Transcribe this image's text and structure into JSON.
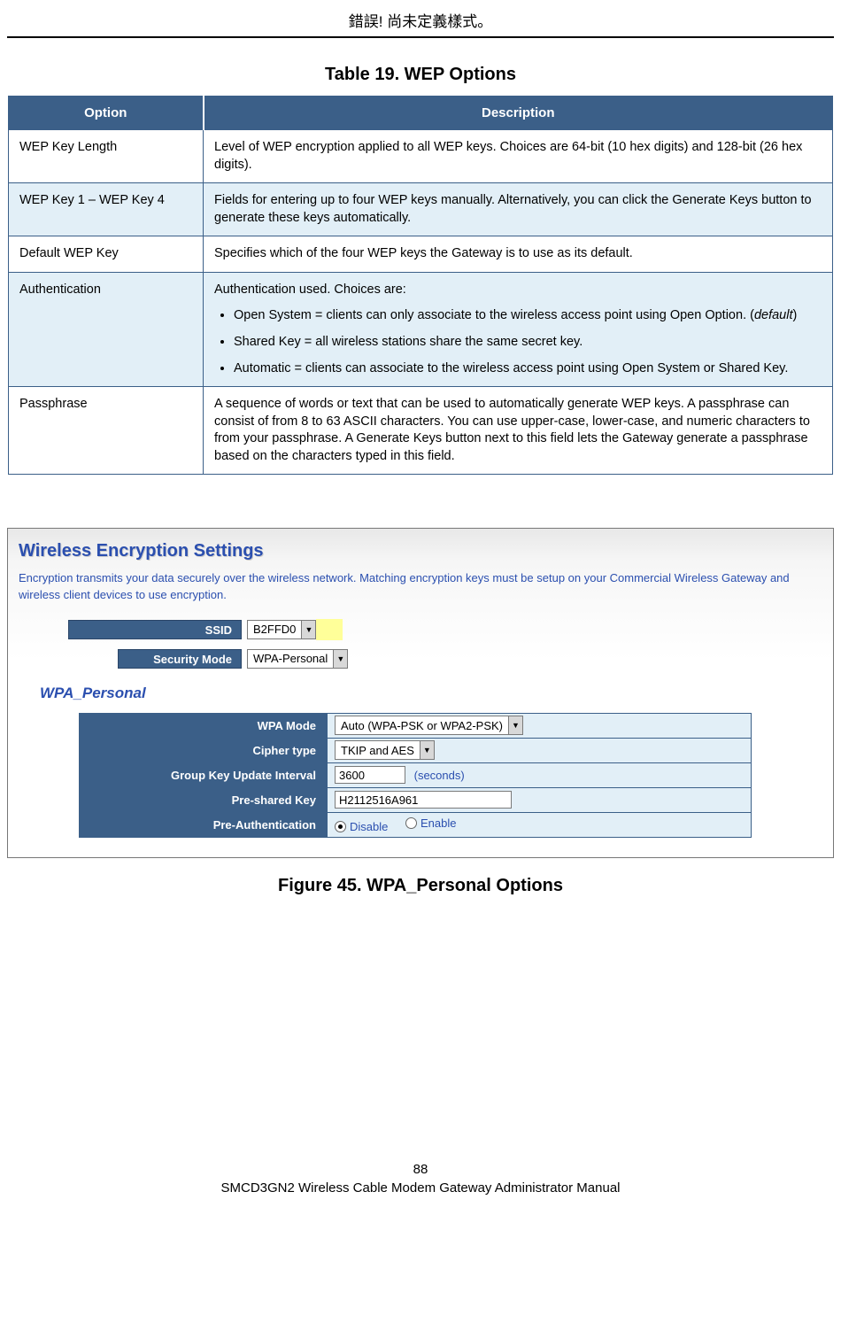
{
  "header": {
    "error_text": "錯誤! 尚未定義樣式。"
  },
  "table": {
    "title": "Table 19. WEP Options",
    "cols": [
      "Option",
      "Description"
    ],
    "rows": [
      {
        "option": "WEP Key Length",
        "desc": "Level of WEP encryption applied to all WEP keys. Choices are 64-bit (10 hex digits) and 128-bit (26 hex digits)."
      },
      {
        "option": "WEP Key 1 – WEP Key 4",
        "desc": "Fields for entering up to four WEP keys manually. Alternatively, you can click the Generate Keys button to generate these keys automatically."
      },
      {
        "option": "Default WEP Key",
        "desc": "Specifies which of the four WEP keys the Gateway is to use as its default."
      },
      {
        "option": "Authentication",
        "desc_intro": "Authentication used. Choices are:",
        "bullets": [
          {
            "text": "Open System = clients can only associate to the wireless access point using Open Option. (",
            "italic": "default",
            "text2": ")"
          },
          {
            "text": "Shared Key = all wireless stations share the same secret key."
          },
          {
            "text": "Automatic = clients can associate to the wireless access point using Open System or Shared Key."
          }
        ]
      },
      {
        "option": "Passphrase",
        "desc": "A sequence of words or text that can be used to automatically generate WEP keys. A passphrase can consist of from 8 to 63 ASCII characters. You can use upper-case, lower-case, and numeric characters to from your passphrase. A Generate Keys button next to this field lets the Gateway generate a passphrase based on the characters typed in this field."
      }
    ]
  },
  "figure": {
    "panel_title": "Wireless Encryption Settings",
    "panel_desc": "Encryption transmits your data securely over the wireless network. Matching encryption keys must be setup on your Commercial Wireless Gateway and wireless client devices to use encryption.",
    "ssid_label": "SSID",
    "ssid_value": "B2FFD0",
    "security_mode_label": "Security Mode",
    "security_mode_value": "WPA-Personal",
    "wpa_subtitle": "WPA_Personal",
    "wpa_rows": [
      {
        "label": "WPA Mode",
        "type": "select",
        "value": "Auto (WPA-PSK or WPA2-PSK)"
      },
      {
        "label": "Cipher type",
        "type": "select",
        "value": "TKIP and AES"
      },
      {
        "label": "Group Key Update Interval",
        "type": "input",
        "value": "3600",
        "suffix": "(seconds)"
      },
      {
        "label": "Pre-shared Key",
        "type": "input",
        "value": "H2112516A961"
      },
      {
        "label": "Pre-Authentication",
        "type": "radio",
        "options": [
          "Disable",
          "Enable"
        ],
        "selected": "Disable"
      }
    ],
    "caption": "Figure 45. WPA_Personal Options"
  },
  "footer": {
    "page_number": "88",
    "manual_title": "SMCD3GN2 Wireless Cable Modem Gateway Administrator Manual"
  }
}
